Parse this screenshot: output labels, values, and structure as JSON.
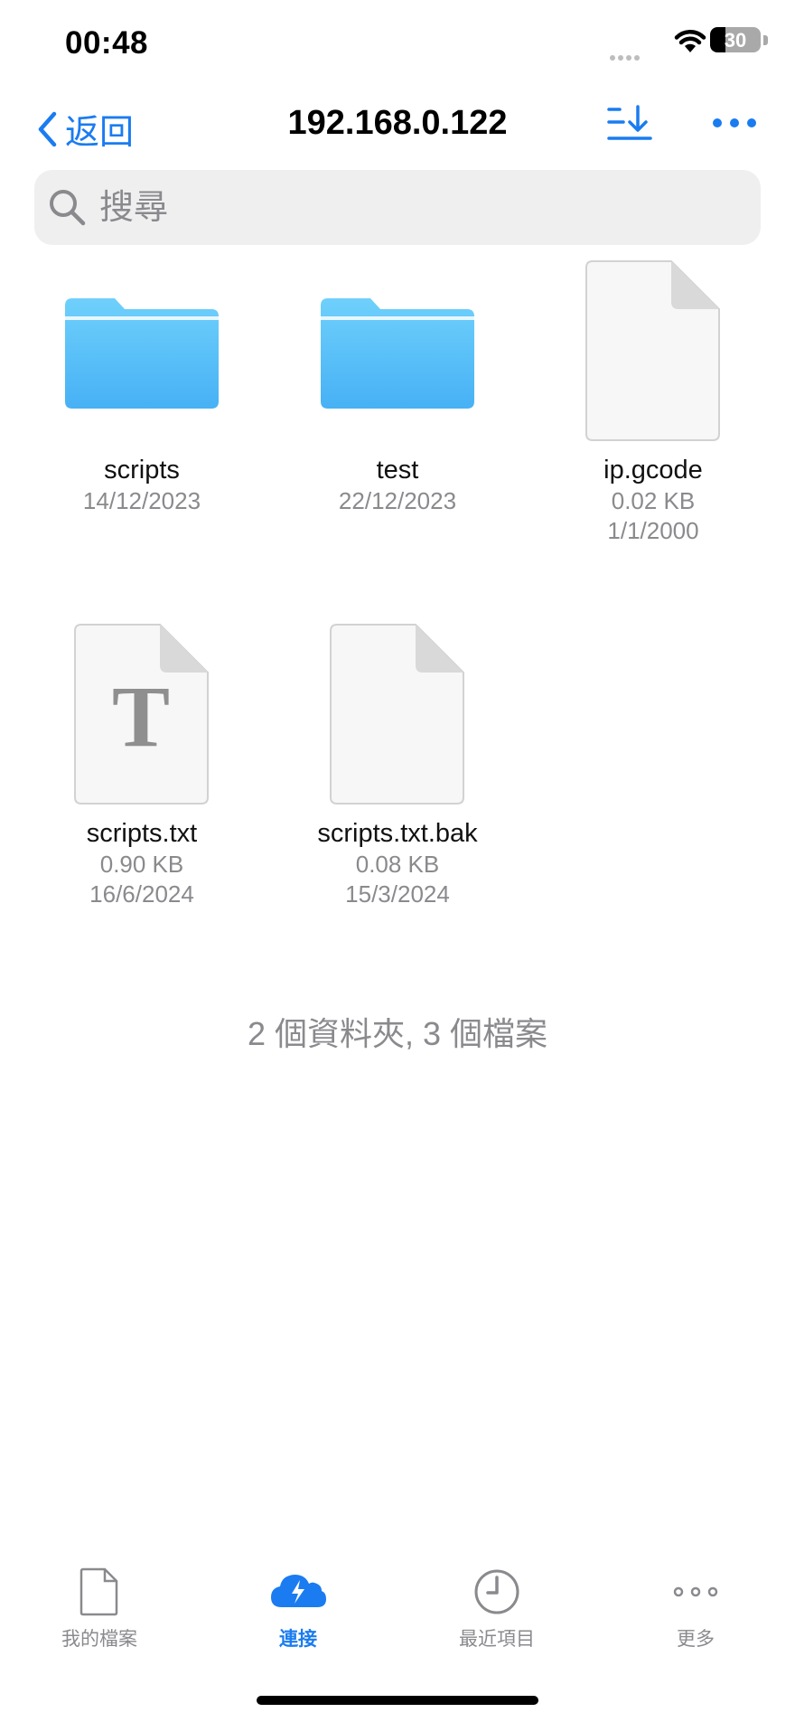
{
  "status_bar": {
    "time": "00:48",
    "battery": "30",
    "battery_level": 0.3
  },
  "nav": {
    "back_label": "返回",
    "title": "192.168.0.122"
  },
  "search": {
    "placeholder": "搜尋"
  },
  "items": [
    {
      "name": "scripts",
      "type": "folder",
      "date": "14/12/2023"
    },
    {
      "name": "test",
      "type": "folder",
      "date": "22/12/2023"
    },
    {
      "name": "ip.gcode",
      "type": "file",
      "size": "0.02 KB",
      "date": "1/1/2000"
    },
    {
      "name": "scripts.txt",
      "type": "text-file",
      "size": "0.90 KB",
      "date": "16/6/2024",
      "glyph": "T"
    },
    {
      "name": "scripts.txt.bak",
      "type": "file",
      "size": "0.08 KB",
      "date": "15/3/2024"
    }
  ],
  "summary": "2 個資料夾, 3 個檔案",
  "tabbar": {
    "tabs": [
      {
        "label": "我的檔案",
        "icon": "document-icon",
        "active": false
      },
      {
        "label": "連接",
        "icon": "cloud-bolt-icon",
        "active": true
      },
      {
        "label": "最近項目",
        "icon": "clock-icon",
        "active": false
      },
      {
        "label": "更多",
        "icon": "more-icon",
        "active": false
      }
    ]
  },
  "colors": {
    "accent": "#1a7cf0",
    "folder_top": "#6fd0fb",
    "folder_bottom": "#47b1f5",
    "secondary_text": "#8a8a8e"
  }
}
